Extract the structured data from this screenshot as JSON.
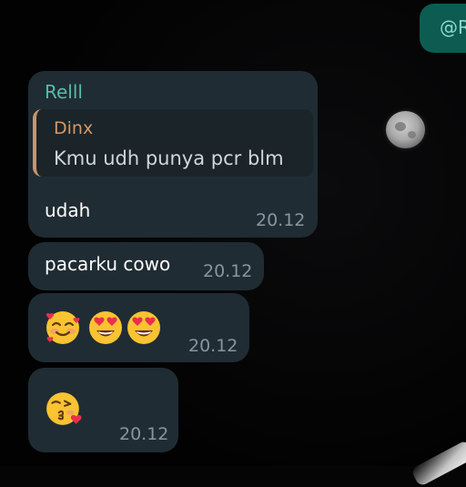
{
  "outgoing": {
    "partial_text": "@R"
  },
  "messages": [
    {
      "sender": "Relll",
      "reply_to": {
        "name": "Dinx",
        "text": "Kmu udh punya pcr blm"
      },
      "text": "udah",
      "time": "20.12"
    },
    {
      "text": "pacarku cowo",
      "time": "20.12"
    },
    {
      "emojis": [
        "smiling-face-with-hearts-emoji",
        "heart-eyes-emoji",
        "heart-eyes-emoji"
      ],
      "time": "20.12"
    },
    {
      "emojis": [
        "face-blowing-kiss-emoji"
      ],
      "time": "20.12"
    }
  ],
  "colors": {
    "bubble_incoming": "#202c33",
    "bubble_outgoing": "#0c5c52",
    "sender_name": "#53bdac",
    "quote_name": "#d59867",
    "timestamp": "#8696a0"
  }
}
